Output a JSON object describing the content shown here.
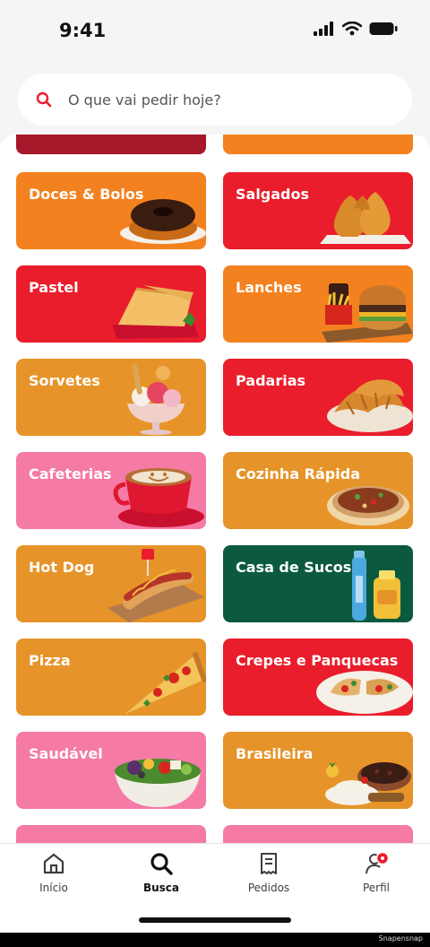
{
  "status_bar": {
    "time": "9:41"
  },
  "search": {
    "placeholder": "O que vai pedir hoje?"
  },
  "categories": [
    {
      "label": "Doces & Bolos",
      "color": "#f4811f",
      "icon": "pudding-icon"
    },
    {
      "label": "Salgados",
      "color": "#ea1d2c",
      "icon": "coxinha-icon"
    },
    {
      "label": "Pastel",
      "color": "#ea1d2c",
      "icon": "pastel-icon"
    },
    {
      "label": "Lanches",
      "color": "#f4811f",
      "icon": "burger-icon"
    },
    {
      "label": "Sorvetes",
      "color": "#e69429",
      "icon": "ice-cream-icon"
    },
    {
      "label": "Padarias",
      "color": "#ea1d2c",
      "icon": "croissant-icon"
    },
    {
      "label": "Cafeterias",
      "color": "#f57aa6",
      "icon": "coffee-cup-icon"
    },
    {
      "label": "Cozinha Rápida",
      "color": "#e69429",
      "icon": "esfiha-icon"
    },
    {
      "label": "Hot Dog",
      "color": "#e69429",
      "icon": "hot-dog-icon"
    },
    {
      "label": "Casa de Sucos",
      "color": "#0b5a3f",
      "icon": "juice-bottle-icon"
    },
    {
      "label": "Pizza",
      "color": "#e69429",
      "icon": "pizza-slice-icon"
    },
    {
      "label": "Crepes e Panquecas",
      "color": "#ea1d2c",
      "icon": "crepe-plate-icon"
    },
    {
      "label": "Saudável",
      "color": "#f57aa6",
      "icon": "salad-bowl-icon"
    },
    {
      "label": "Brasileira",
      "color": "#e69429",
      "icon": "feijoada-icon"
    }
  ],
  "nav": {
    "items": [
      {
        "label": "Início",
        "icon": "home-icon"
      },
      {
        "label": "Busca",
        "icon": "search-icon",
        "active": true
      },
      {
        "label": "Pedidos",
        "icon": "receipt-icon"
      },
      {
        "label": "Perfil",
        "icon": "profile-icon",
        "badge": true
      }
    ]
  },
  "watermark": "Snapensnap"
}
